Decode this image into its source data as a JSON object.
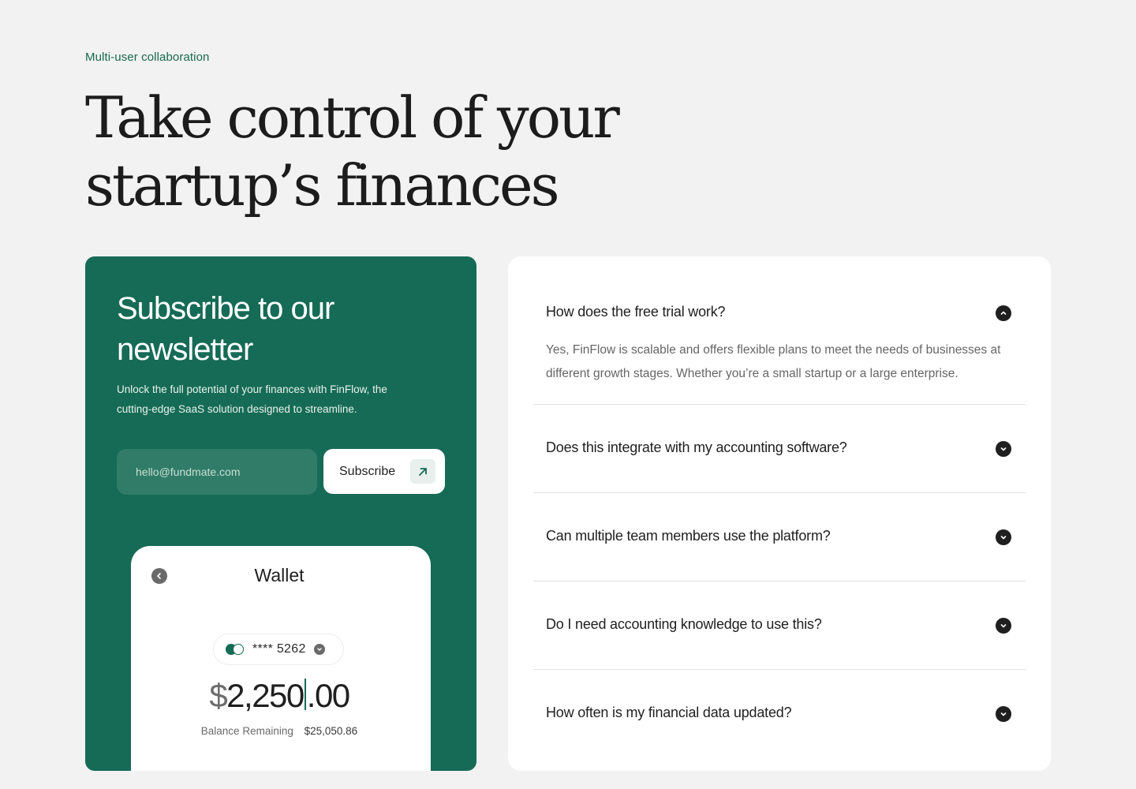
{
  "hero": {
    "eyebrow": "Multi-user collaboration",
    "title_line1": "Take control of your",
    "title_line2": "startup’s finances"
  },
  "newsletter": {
    "title": "Subscribe to our newsletter",
    "description": "Unlock the full potential of your finances with FinFlow, the cutting-edge SaaS solution designed to streamline.",
    "email_placeholder": "hello@fundmate.com",
    "subscribe_label": "Subscribe",
    "accent_color": "#166b56"
  },
  "wallet": {
    "title": "Wallet",
    "card_number": "**** 5262",
    "currency": "$",
    "amount_whole": "2,250",
    "amount_decimal": ".00",
    "balance_label": "Balance Remaining",
    "balance_value": "$25,050.86"
  },
  "faq": {
    "items": [
      {
        "question": "How does the free trial work?",
        "answer": "Yes, FinFlow is scalable and offers flexible plans to meet the needs of businesses at different growth stages. Whether you’re a small startup or a large enterprise.",
        "expanded": true
      },
      {
        "question": "Does this integrate with my accounting software?",
        "expanded": false
      },
      {
        "question": "Can multiple team members use the platform?",
        "expanded": false
      },
      {
        "question": "Do I need accounting knowledge to use this?",
        "expanded": false
      },
      {
        "question": "How often is my financial data updated?",
        "expanded": false
      }
    ]
  }
}
